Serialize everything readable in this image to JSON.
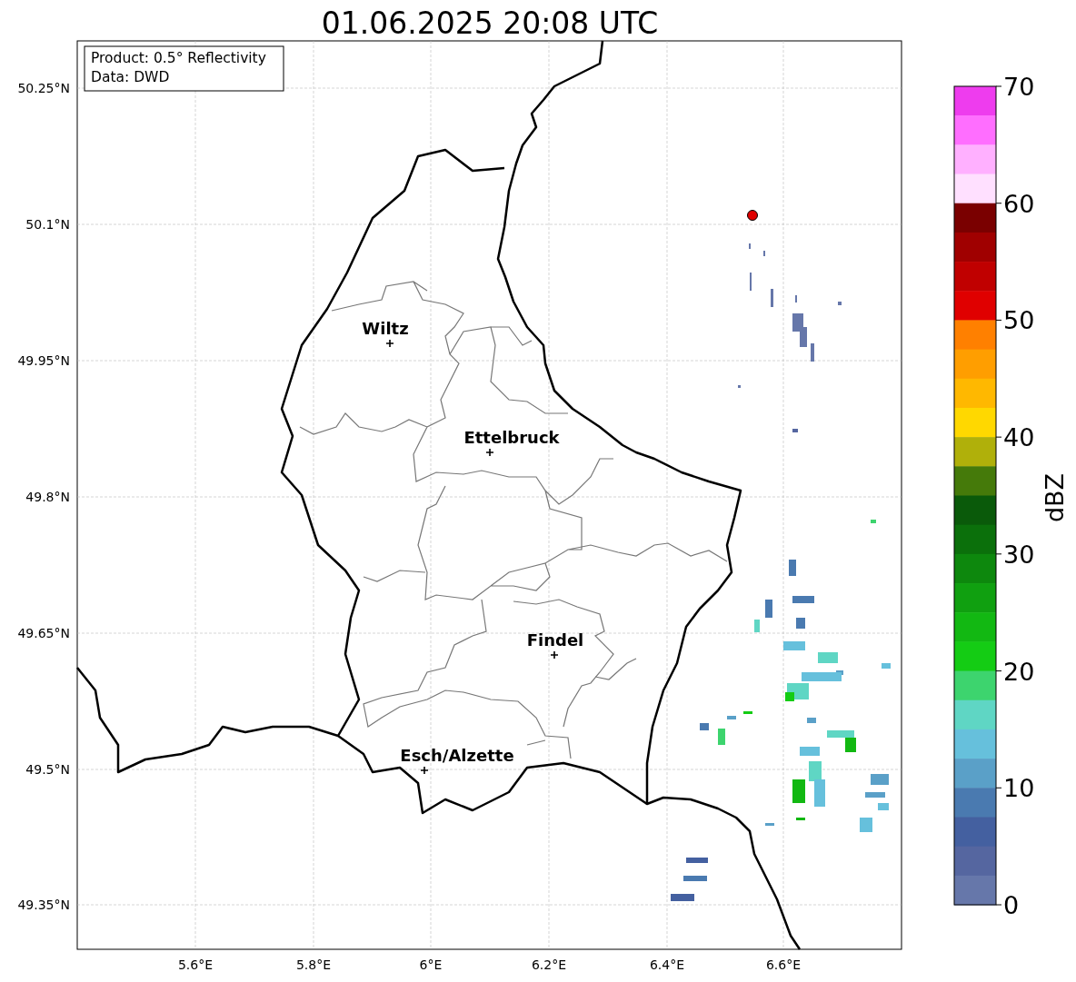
{
  "title": "01.06.2025 20:08 UTC",
  "info_box": [
    "Product: 0.5° Reflectivity",
    "Data: DWD"
  ],
  "lat_ticks": [
    "50.25°N",
    "50.1°N",
    "49.95°N",
    "49.8°N",
    "49.65°N",
    "49.5°N",
    "49.35°N"
  ],
  "lon_ticks": [
    "5.6°E",
    "5.8°E",
    "6°E",
    "6.2°E",
    "6.4°E",
    "6.6°E"
  ],
  "cities": [
    {
      "name": "Wiltz"
    },
    {
      "name": "Ettelbruck"
    },
    {
      "name": "Findel"
    },
    {
      "name": "Esch/Alzette"
    }
  ],
  "colorbar": {
    "label": "dBZ",
    "ticks": [
      "70",
      "60",
      "50",
      "40",
      "30",
      "20",
      "10",
      "0"
    ],
    "segments": [
      {
        "color": "#ee3cee"
      },
      {
        "color": "#ff6eff"
      },
      {
        "color": "#ffb0ff"
      },
      {
        "color": "#ffe0ff"
      },
      {
        "color": "#7a0000"
      },
      {
        "color": "#a00000"
      },
      {
        "color": "#c00000"
      },
      {
        "color": "#e00000"
      },
      {
        "color": "#ff8000"
      },
      {
        "color": "#ff9e00"
      },
      {
        "color": "#ffb800"
      },
      {
        "color": "#ffd800"
      },
      {
        "color": "#b0b00a"
      },
      {
        "color": "#457a0a"
      },
      {
        "color": "#0a5a0a"
      },
      {
        "color": "#0b700b"
      },
      {
        "color": "#0d880d"
      },
      {
        "color": "#10a010"
      },
      {
        "color": "#12b812"
      },
      {
        "color": "#14cc14"
      },
      {
        "color": "#3dd46e"
      },
      {
        "color": "#5fd6c4"
      },
      {
        "color": "#66c0dc"
      },
      {
        "color": "#5aa0c8"
      },
      {
        "color": "#4a7ab0"
      },
      {
        "color": "#4460a0"
      },
      {
        "color": "#5566a0"
      },
      {
        "color": "#6677aa"
      }
    ]
  }
}
